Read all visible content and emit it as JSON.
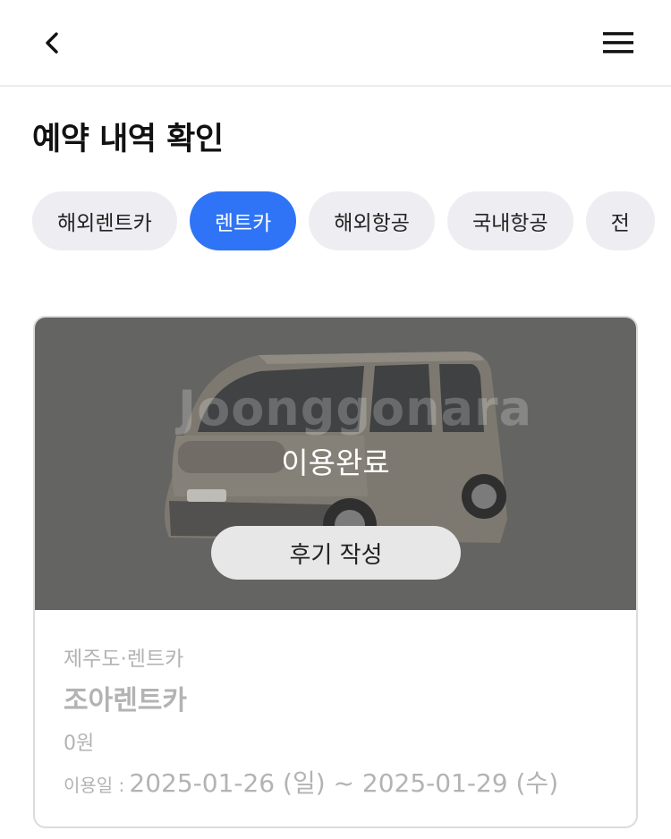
{
  "header": {
    "back_icon": "chevron-left-icon",
    "menu_icon": "hamburger-menu-icon"
  },
  "page": {
    "title": "예약 내역 확인"
  },
  "tabs": [
    {
      "label": "해외렌트카",
      "active": false
    },
    {
      "label": "렌트카",
      "active": true
    },
    {
      "label": "해외항공",
      "active": false
    },
    {
      "label": "국내항공",
      "active": false
    },
    {
      "label": "전",
      "active": false
    }
  ],
  "colors": {
    "accent": "#2f74f6",
    "tab_bg": "#eeeef2",
    "overlay": "#6c6c6a",
    "muted_text": "#b3b3b3"
  },
  "reservation": {
    "watermark": "Joonggonara",
    "status": "이용완료",
    "review_button": "후기 작성",
    "category": "제주도·렌트카",
    "vendor": "조아렌트카",
    "price": "0원",
    "date_label": "이용일 :",
    "date_range": "2025-01-26 (일) ~ 2025-01-29 (수)"
  }
}
